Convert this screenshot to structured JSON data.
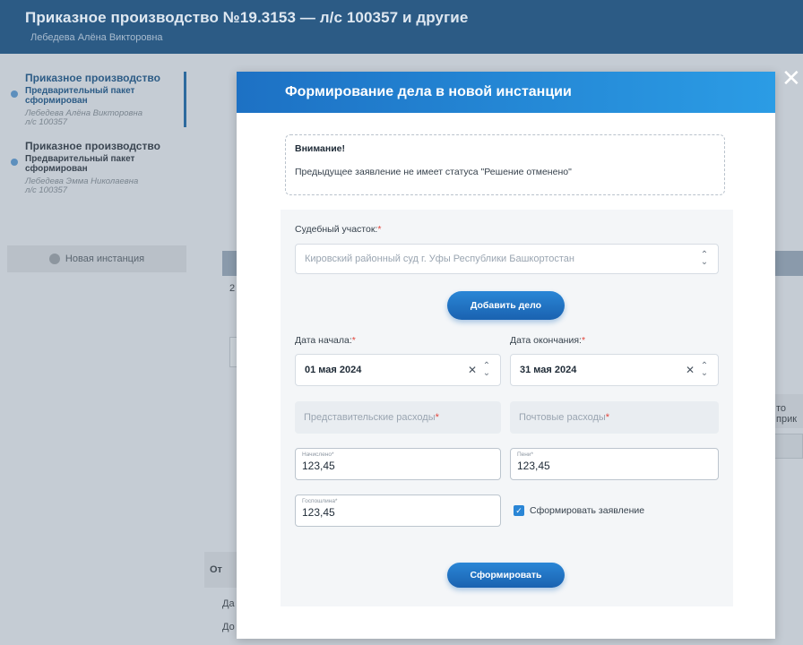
{
  "background": {
    "title": "Приказное производство №19.3153 — л/с 100357 и другие",
    "subtitle": "Лебедева Алёна Викторовна",
    "sidebar_items": [
      {
        "title": "Приказное производство",
        "status": "Предварительный пакет сформирован",
        "person": "Лебедева Алёна Викторовна",
        "account": "л/с 100357"
      },
      {
        "title": "Приказное производство",
        "status": "Предварительный пакет сформирован",
        "person": "Лебедева Эмма Николаевна",
        "account": "л/с 100357"
      }
    ],
    "new_instance_label": "Новая инстанция",
    "fragments": {
      "row_num": "2",
      "right_text": "то прик",
      "left_o": "От",
      "left_da": "Да",
      "left_do": "До"
    }
  },
  "modal": {
    "title": "Формирование дела в новой инстанции",
    "notice": {
      "title": "Внимание!",
      "text": "Предыдущее заявление не имеет статуса \"Решение отменено\""
    },
    "court": {
      "label": "Судебный участок:",
      "required_mark": "*",
      "placeholder": "Кировский районный суд г. Уфы Республики Башкортостан"
    },
    "add_case_button": "Добавить дело",
    "start_date": {
      "label": "Дата начала:",
      "required_mark": "*",
      "value": "01 мая 2024"
    },
    "end_date": {
      "label": "Дата окончания:",
      "required_mark": "*",
      "value": "31 мая 2024"
    },
    "rep_expenses": {
      "label": "Представительские расходы",
      "required_mark": "*"
    },
    "postal_expenses": {
      "label": "Почтовые расходы",
      "required_mark": "*"
    },
    "accrued": {
      "label": "Начислено*",
      "value": "123,45"
    },
    "penalty": {
      "label": "Пени*",
      "value": "123,45"
    },
    "duty": {
      "label": "Госпошлина*",
      "value": "123,45"
    },
    "form_statement": {
      "label": "Сформировать заявление",
      "checked": true
    },
    "submit_button": "Сформировать",
    "close_symbol": "✕"
  }
}
